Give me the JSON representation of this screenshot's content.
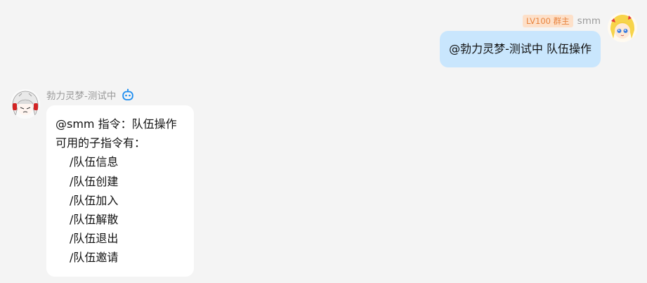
{
  "outgoing": {
    "level_badge": "LV100 群主",
    "sender_name": "smm",
    "message": "@勃力灵梦-测试中 队伍操作"
  },
  "incoming": {
    "sender_name": "勃力灵梦-测试中",
    "bot_icon": "robot-icon",
    "lines": [
      "@smm 指令：队伍操作",
      "可用的子指令有：",
      "/队伍信息",
      "/队伍创建",
      "/队伍加入",
      "/队伍解散",
      "/队伍退出",
      "/队伍邀请"
    ]
  },
  "colors": {
    "background": "#f4f4f4",
    "outgoing_bubble": "#c9e6fd",
    "incoming_bubble": "#ffffff",
    "level_badge_bg": "#fde0c9",
    "level_badge_text": "#e8843f",
    "bot_icon": "#1a8cf0"
  }
}
